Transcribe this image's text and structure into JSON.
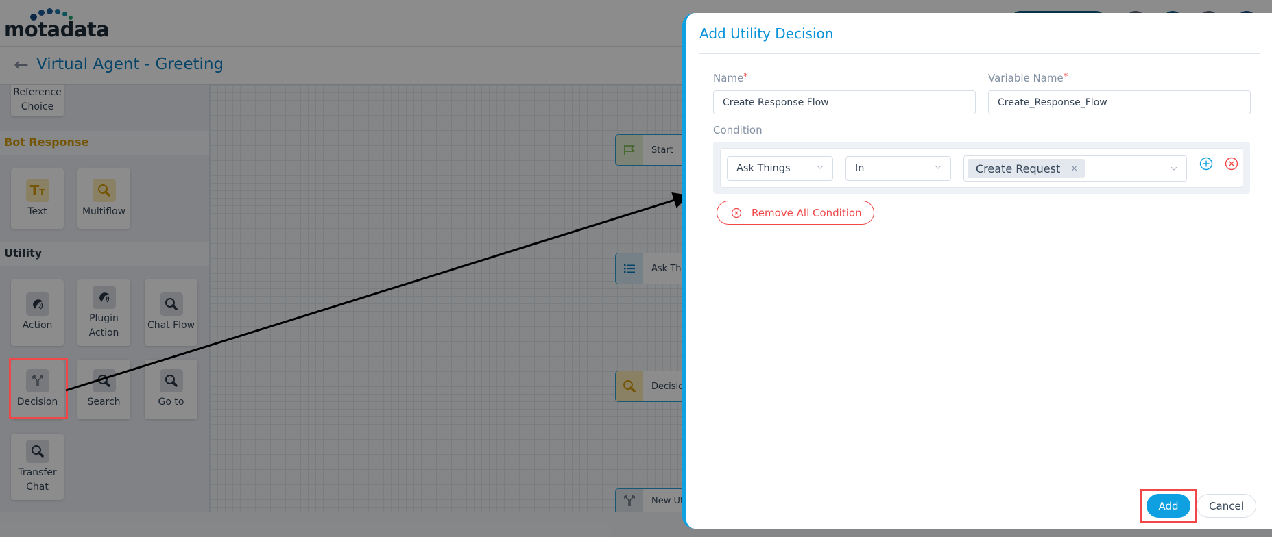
{
  "header": {
    "logo_text": "motadata",
    "page_title": "Virtual Agent - Greeting",
    "back_icon": "arrow-left-icon"
  },
  "sidebar": {
    "partial_card": {
      "label": "Reference Choice"
    },
    "sections": [
      {
        "title": "Bot Response",
        "color": "#d59c0b",
        "items": [
          {
            "label": "Text",
            "icon": "text-format-icon"
          },
          {
            "label": "Multiflow",
            "icon": "search-icon"
          }
        ]
      },
      {
        "title": "Utility",
        "color": "#2a3544",
        "items": [
          {
            "label": "Action",
            "icon": "action-icon"
          },
          {
            "label": "Plugin Action",
            "icon": "plugin-action-icon"
          },
          {
            "label": "Chat Flow",
            "icon": "search-icon"
          },
          {
            "label": "Decision",
            "icon": "decision-fork-icon",
            "highlighted": true
          },
          {
            "label": "Search",
            "icon": "search-icon"
          },
          {
            "label": "Go to",
            "icon": "search-icon"
          },
          {
            "label": "Transfer Chat",
            "icon": "search-icon"
          }
        ]
      }
    ]
  },
  "canvas": {
    "nodes": [
      {
        "label": "Start",
        "icon": "flag-icon"
      },
      {
        "label": "Ask Thin",
        "icon": "list-icon"
      },
      {
        "label": "Decision",
        "icon": "search-icon"
      },
      {
        "label": "New Utili",
        "icon": "decision-fork-icon"
      }
    ]
  },
  "dialog": {
    "title": "Add Utility Decision",
    "name_label": "Name",
    "name_value": "Create Response Flow",
    "variable_label": "Variable Name",
    "variable_value": "Create_Response_Flow",
    "required_mark": "*",
    "condition_label": "Condition",
    "condition": {
      "field": "Ask Things",
      "operator": "In",
      "values": [
        "Create Request"
      ],
      "chip_remove": "×"
    },
    "remove_all_label": "Remove All Condition",
    "add_label": "Add",
    "cancel_label": "Cancel"
  },
  "colors": {
    "accent": "#0ea0e0",
    "danger": "#f04848",
    "title": "#0a93d8"
  }
}
